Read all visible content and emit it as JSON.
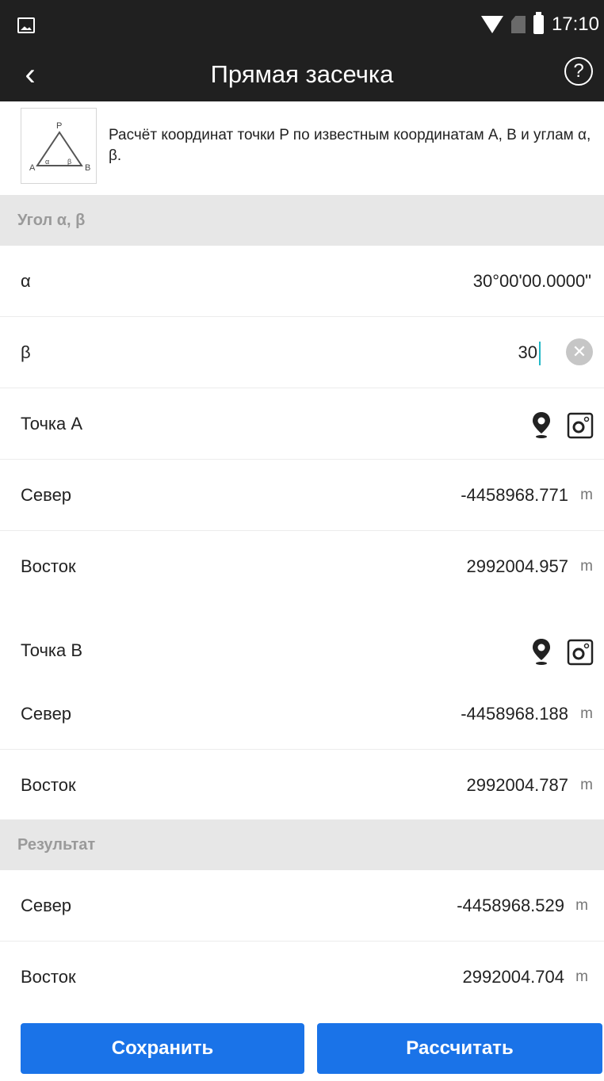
{
  "status_bar": {
    "time": "17:10"
  },
  "app_bar": {
    "title": "Прямая засечка",
    "help_label": "?"
  },
  "intro": {
    "description": "Расчёт координат точки P по известным координатам A, B и углам α, β.",
    "thumb": {
      "p": "P",
      "a": "A",
      "b": "B",
      "alpha": "α",
      "beta": "β"
    }
  },
  "angles": {
    "header": "Угол α,  β",
    "alpha_label": "α",
    "alpha_value": "30°00'00.0000\"",
    "beta_label": "β",
    "beta_value": "30"
  },
  "point_a": {
    "title": "Точка A",
    "north_label": "Север",
    "north_value": "-4458968.771",
    "north_unit": "m",
    "east_label": "Восток",
    "east_value": "2992004.957",
    "east_unit": "m"
  },
  "point_b": {
    "title": "Точка B",
    "north_label": "Север",
    "north_value": "-4458968.188",
    "north_unit": "m",
    "east_label": "Восток",
    "east_value": "2992004.787",
    "east_unit": "m"
  },
  "result": {
    "header": "Результат",
    "north_label": "Север",
    "north_value": "-4458968.529",
    "north_unit": "m",
    "east_label": "Восток",
    "east_value": "2992004.704",
    "east_unit": "m"
  },
  "buttons": {
    "save": "Сохранить",
    "calculate": "Рассчитать"
  },
  "colors": {
    "bar": "#202020",
    "accent": "#1a73e8",
    "section_bg": "#e7e7e7",
    "cursor": "#22b8c7"
  },
  "icons": [
    "gallery-icon",
    "wifi-icon",
    "no-sim-icon",
    "battery-icon",
    "back-icon",
    "help-icon",
    "location-pin-icon",
    "map-point-icon",
    "clear-icon"
  ]
}
